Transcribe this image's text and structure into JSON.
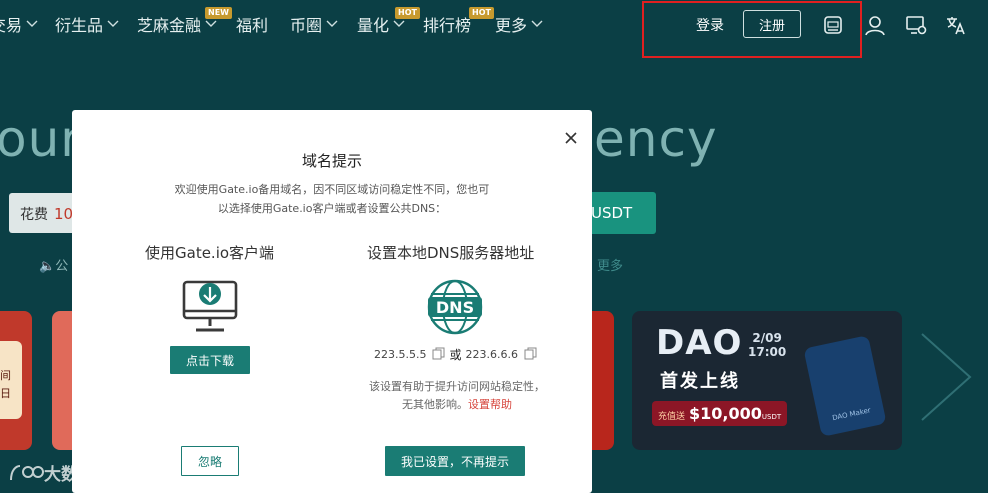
{
  "nav": {
    "items": [
      {
        "label": "交易",
        "chevron": true
      },
      {
        "label": "衍生品",
        "chevron": true
      },
      {
        "label": "芝麻金融",
        "chevron": true,
        "tag": "NEW"
      },
      {
        "label": "福利",
        "chevron": false
      },
      {
        "label": "币圈",
        "chevron": true
      },
      {
        "label": "量化",
        "chevron": true,
        "tag": "HOT"
      },
      {
        "label": "排行榜",
        "chevron": false,
        "tag": "HOT"
      },
      {
        "label": "更多",
        "chevron": true
      }
    ],
    "login": "登录",
    "register": "注册",
    "icons": [
      "app-download-icon",
      "user-icon",
      "settings-icon",
      "language-icon"
    ]
  },
  "hero": {
    "left_text": "our",
    "right_text": "ency",
    "price_label": "花费",
    "price_value": "10",
    "usdt_label": "USDT",
    "announcement_prefix": "公",
    "more_link": "更多"
  },
  "banners": {
    "red_card_lines": [
      "间",
      "日"
    ],
    "dao": {
      "title": "DAO",
      "date": "2/09",
      "time": "17:00",
      "subtitle": "首发上线",
      "prize_prefix": "充值送",
      "prize_amount": "$10,000",
      "prize_unit": "USDT",
      "card_label": "DAO Maker"
    }
  },
  "watermark": "大数跨境",
  "modal": {
    "title": "域名提示",
    "description_line1": "欢迎使用Gate.io备用域名，因不同区域访问稳定性不同，您也可",
    "description_line2": "以选择使用Gate.io客户端或者设置公共DNS：",
    "client_title": "使用Gate.io客户端",
    "download_button": "点击下载",
    "dns_title": "设置本地DNS服务器地址",
    "dns_icon_text": "DNS",
    "dns_primary": "223.5.5.5",
    "dns_or": "或",
    "dns_secondary": "223.6.6.6",
    "dns_note_line1": "该设置有助于提升访问网站稳定性，",
    "dns_note_line2": "无其他影响。",
    "help_link": "设置帮助",
    "ignore_button": "忽略",
    "confirm_button": "我已设置，不再提示"
  },
  "colors": {
    "background": "#0b3f45",
    "accent": "#1a7c74",
    "highlight_box": "#e02020",
    "link_red": "#d6433a"
  }
}
